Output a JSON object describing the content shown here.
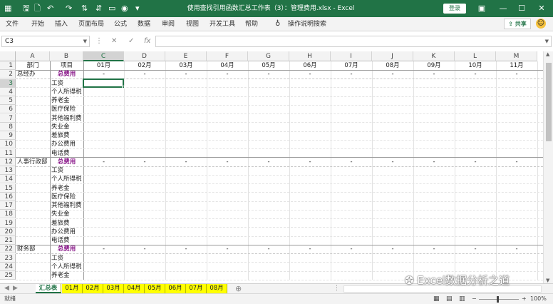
{
  "titlebar": {
    "title": "使用查找引用函数汇总工作表（3）：管理费用.xlsx - Excel",
    "login_label": "登录",
    "brand_color": "#217346"
  },
  "menu": {
    "items": [
      "文件",
      "开始",
      "插入",
      "页面布局",
      "公式",
      "数据",
      "审阅",
      "视图",
      "开发工具",
      "帮助"
    ],
    "tell_me": "操作说明搜索",
    "share": "共享"
  },
  "formula_bar": {
    "name_box": "C3",
    "fx": "fx",
    "value": ""
  },
  "columns": [
    "A",
    "B",
    "C",
    "D",
    "E",
    "F",
    "G",
    "H",
    "I",
    "J",
    "K",
    "L",
    "M"
  ],
  "selected_column": "C",
  "selected_row": "3",
  "row_numbers": [
    "1",
    "2",
    "3",
    "4",
    "5",
    "6",
    "7",
    "8",
    "9",
    "10",
    "11",
    "12",
    "13",
    "14",
    "15",
    "16",
    "17",
    "18",
    "19",
    "20",
    "21",
    "22",
    "23",
    "24",
    "25"
  ],
  "header_row": {
    "a": "部门",
    "b": "项目",
    "months": [
      "01月",
      "02月",
      "03月",
      "04月",
      "05月",
      "06月",
      "07月",
      "08月",
      "09月",
      "10月",
      "11月"
    ]
  },
  "total_label": "总费用",
  "dash": "-",
  "departments": [
    "总经办",
    "人事行政部",
    "财务部"
  ],
  "expense_items": [
    "工资",
    "个人所得税",
    "养老金",
    "医疗保险",
    "其他福利费",
    "失业金",
    "差旅费",
    "办公费用",
    "电话费"
  ],
  "sheet_tabs": {
    "active": "汇总表",
    "others": [
      "01月",
      "02月",
      "03月",
      "04月",
      "05月",
      "06月",
      "07月",
      "08月"
    ],
    "tab_color": "#ffff00"
  },
  "status": {
    "left": "就绪",
    "zoom": "100%"
  },
  "watermark": "Excel数据分析之道"
}
